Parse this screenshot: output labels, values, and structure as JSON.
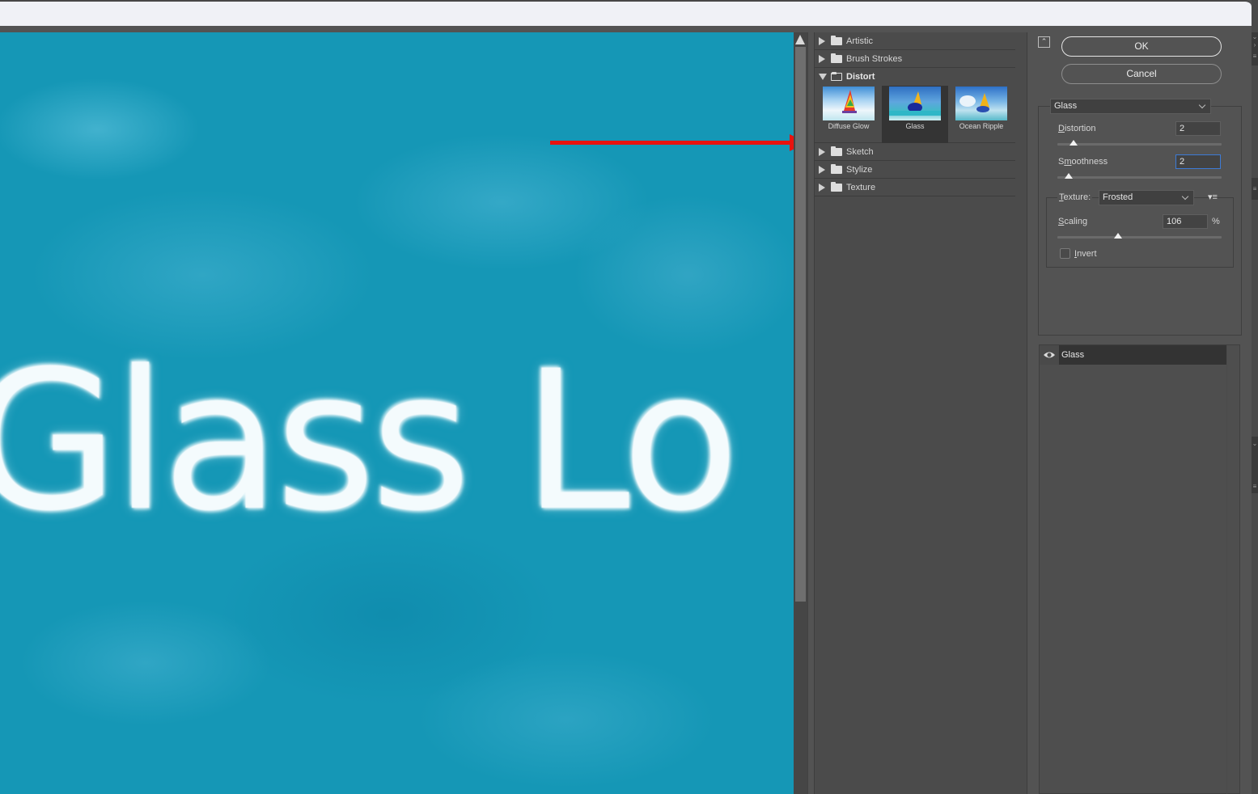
{
  "window": {
    "title": ""
  },
  "preview": {
    "image_text": "Glass Lo",
    "annotation": "red-arrow pointing to Glass filter thumbnail",
    "colors": {
      "water": "#1597b6",
      "arrow": "#e8130f"
    }
  },
  "gallery": {
    "categories": [
      {
        "label": "Artistic",
        "expanded": false
      },
      {
        "label": "Brush Strokes",
        "expanded": false
      },
      {
        "label": "Distort",
        "expanded": true
      },
      {
        "label": "Sketch",
        "expanded": false
      },
      {
        "label": "Stylize",
        "expanded": false
      },
      {
        "label": "Texture",
        "expanded": false
      }
    ],
    "distort_filters": [
      {
        "label": "Diffuse Glow",
        "selected": false
      },
      {
        "label": "Glass",
        "selected": true
      },
      {
        "label": "Ocean Ripple",
        "selected": false
      }
    ]
  },
  "buttons": {
    "ok": "OK",
    "cancel": "Cancel"
  },
  "settings": {
    "filter_select": "Glass",
    "distortion": {
      "label_pre": "",
      "label_u": "D",
      "label_post": "istortion",
      "value": "2",
      "min": 0,
      "max": 20,
      "fraction": 0.1
    },
    "smoothness": {
      "label_pre": "S",
      "label_u": "m",
      "label_post": "oothness",
      "value": "2",
      "min": 1,
      "max": 15,
      "fraction": 0.07
    },
    "texture": {
      "label_u": "T",
      "label_post": "exture:",
      "value": "Frosted"
    },
    "scaling": {
      "label_u": "S",
      "label_post": "caling",
      "value": "106",
      "unit": "%",
      "min": 50,
      "max": 200,
      "fraction": 0.37
    },
    "invert": {
      "label_u": "I",
      "label_post": "nvert",
      "checked": false
    }
  },
  "effect_layers": [
    {
      "name": "Glass",
      "visible": true
    }
  ]
}
